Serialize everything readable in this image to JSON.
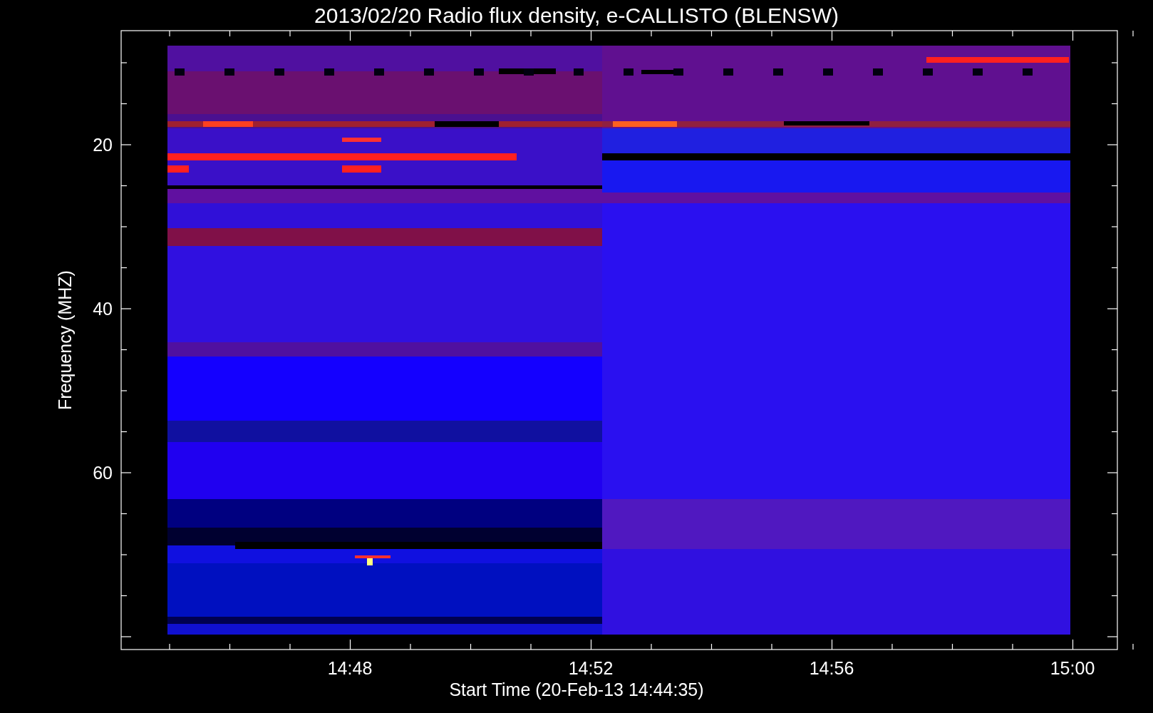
{
  "title": "2013/02/20  Radio flux density, e-CALLISTO (BLENSW)",
  "xlabel": "Start Time (20-Feb-13 14:44:35)",
  "ylabel": "Frequency (MHZ)",
  "xticks": [
    "14:48",
    "14:52",
    "14:56",
    "15:00"
  ],
  "yticks": [
    "20",
    "40",
    "60"
  ]
}
